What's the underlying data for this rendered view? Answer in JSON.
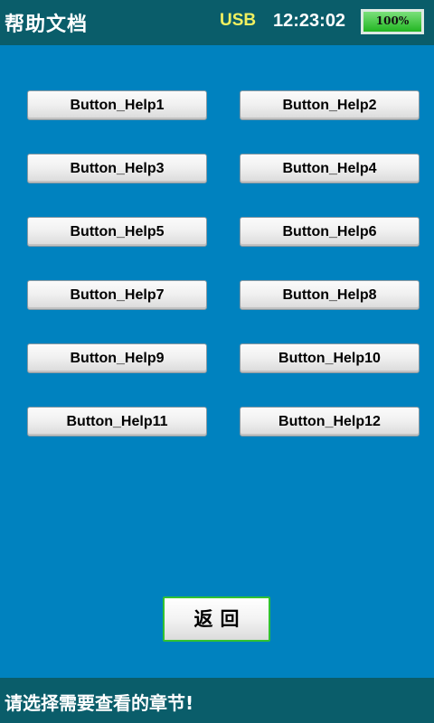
{
  "header": {
    "title": "帮助文档",
    "usb_label": "USB",
    "time": "12:23:02",
    "battery": {
      "label": "100%",
      "level": 1.0
    }
  },
  "help_buttons": [
    "Button_Help1",
    "Button_Help2",
    "Button_Help3",
    "Button_Help4",
    "Button_Help5",
    "Button_Help6",
    "Button_Help7",
    "Button_Help8",
    "Button_Help9",
    "Button_Help10",
    "Button_Help11",
    "Button_Help12"
  ],
  "back_button": {
    "label": "返回"
  },
  "footer": {
    "status": "请选择需要查看的章节!"
  }
}
